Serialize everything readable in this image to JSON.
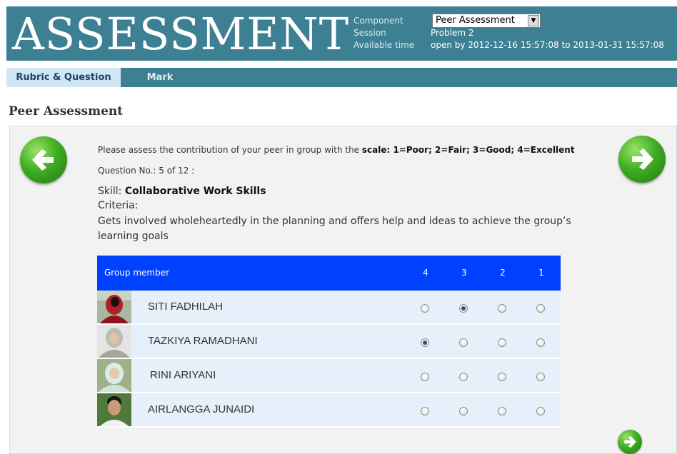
{
  "header": {
    "logo": "ASSESSMENT",
    "labels": {
      "component": "Component",
      "session": "Session",
      "available_time": "Available time"
    },
    "component_value": "Peer Assessment",
    "session_value": "Problem 2",
    "available_time_value": "open by 2012-12-16 15:57:08 to 2013-01-31 15:57:08"
  },
  "tabs": [
    {
      "label": "Rubric & Question",
      "active": true
    },
    {
      "label": "Mark",
      "active": false
    }
  ],
  "page_title": "Peer Assessment",
  "instruction": {
    "prefix": "Please assess the contribution of your peer in group with the ",
    "scale": "scale: 1=Poor; 2=Fair; 3=Good; 4=Excellent"
  },
  "question": {
    "label": "Question No.: 5 of 12 :"
  },
  "skill": {
    "label": "Skill: ",
    "value": "Collaborative Work Skills"
  },
  "criteria": {
    "label": "Criteria:",
    "text": "Gets involved wholeheartedly in the planning and offers help and ideas to achieve the group’s learning goals"
  },
  "table": {
    "header_member": "Group member",
    "columns": [
      "4",
      "3",
      "2",
      "1"
    ],
    "rows": [
      {
        "name": "SITI FADHILAH",
        "selected": "3"
      },
      {
        "name": "TAZKIYA RAMADHANI",
        "selected": "4"
      },
      {
        "name": "RINI ARIYANI",
        "selected": null
      },
      {
        "name": "AIRLANGGA JUNAIDI",
        "selected": null
      }
    ]
  },
  "colors": {
    "banner": "#3e8093",
    "table_header": "#0040ff",
    "row_bg": "#e6f0fa",
    "nav_green": "#3fae22"
  }
}
